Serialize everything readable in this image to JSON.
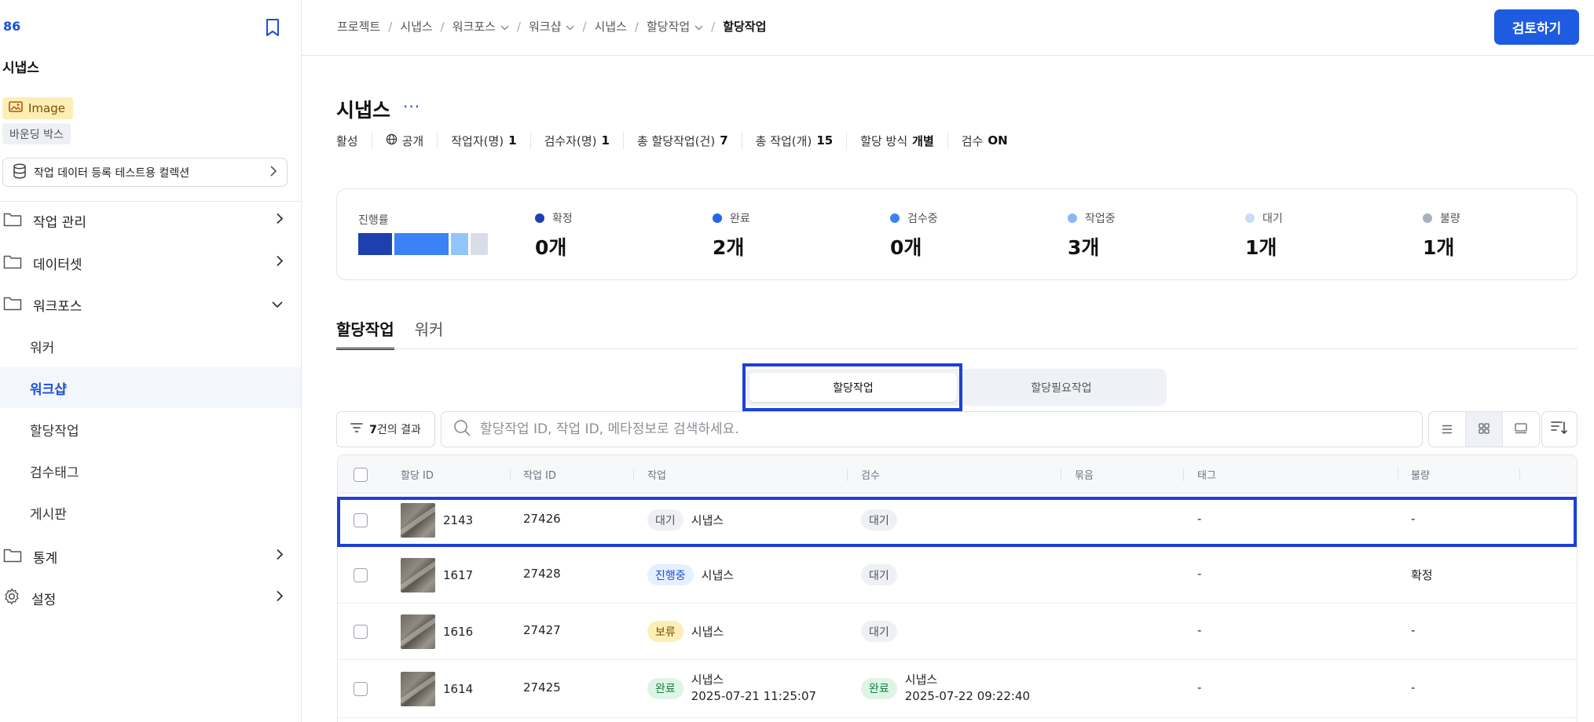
{
  "sidebar": {
    "project_id": "86",
    "project_title": "시냅스",
    "type_badge": "Image",
    "label_badge": "바운딩 박스",
    "collection": "작업 데이터 등록 테스트용 컬렉션",
    "nav": [
      {
        "label": "작업 관리",
        "icon": "folder-icon",
        "state": "collapsed"
      },
      {
        "label": "데이터셋",
        "icon": "folder-icon",
        "state": "collapsed"
      },
      {
        "label": "워크포스",
        "icon": "folder-icon",
        "state": "expanded"
      },
      {
        "label": "통계",
        "icon": "folder-icon",
        "state": "collapsed"
      },
      {
        "label": "설정",
        "icon": "gear-icon",
        "state": "collapsed"
      }
    ],
    "sub_items": [
      "워커",
      "워크샵",
      "할당작업",
      "검수태그",
      "게시판"
    ],
    "active_sub_item": "워크샵"
  },
  "breadcrumb": [
    "프로젝트",
    "시냅스",
    "워크포스",
    "워크샵",
    "시냅스",
    "할당작업",
    "할당작업"
  ],
  "review_button": "검토하기",
  "header": {
    "title": "시냅스",
    "more": "···",
    "meta": [
      {
        "label": "활성",
        "value": ""
      },
      {
        "label": "공개",
        "value": "",
        "icon": "globe-icon"
      },
      {
        "label": "작업자(명)",
        "value": "1"
      },
      {
        "label": "검수자(명)",
        "value": "1"
      },
      {
        "label": "총 할당작업(건)",
        "value": "7"
      },
      {
        "label": "총 작업(개)",
        "value": "15"
      },
      {
        "label": "할당 방식",
        "value": "개별"
      },
      {
        "label": "검수",
        "value": "ON"
      }
    ]
  },
  "stats": {
    "progress_label": "진행률",
    "items": [
      {
        "label": "확정",
        "value": "0개",
        "color": "#1e3fb5"
      },
      {
        "label": "완료",
        "value": "2개",
        "color": "#2563eb"
      },
      {
        "label": "검수중",
        "value": "0개",
        "color": "#3b82f6"
      },
      {
        "label": "작업중",
        "value": "3개",
        "color": "#8ab8f5"
      },
      {
        "label": "대기",
        "value": "1개",
        "color": "#c9dcf5"
      },
      {
        "label": "불량",
        "value": "1개",
        "color": "#a9b0bb"
      }
    ],
    "progress_segments": [
      {
        "color": "#1e40af",
        "fraction": 0.2
      },
      {
        "color": "#3b82f6",
        "fraction": 0.32
      },
      {
        "color": "#93c5fd",
        "fraction": 0.1
      },
      {
        "color": "#d8dee8",
        "fraction": 0.1
      }
    ]
  },
  "tabs": [
    "할당작업",
    "워커"
  ],
  "active_tab": "할당작업",
  "segmented": [
    "할당작업",
    "할당필요작업"
  ],
  "active_segment": "할당작업",
  "toolbar": {
    "result_count": "7",
    "result_suffix": "건의 결과",
    "search_placeholder": "할당작업 ID, 작업 ID, 메타정보로 검색하세요."
  },
  "table": {
    "columns": [
      "할당 ID",
      "작업 ID",
      "작업",
      "검수",
      "묶음",
      "태그",
      "불량"
    ],
    "rows": [
      {
        "assign_id": "2143",
        "task_id": "27426",
        "work_status": "대기",
        "work_status_color": "gray",
        "work_name": "시냅스",
        "work_time": "",
        "review_status": "대기",
        "review_status_color": "gray",
        "review_name": "",
        "review_time": "",
        "bundle": "",
        "tag": "-",
        "defect": "-"
      },
      {
        "assign_id": "1617",
        "task_id": "27428",
        "work_status": "진행중",
        "work_status_color": "blue",
        "work_name": "시냅스",
        "work_time": "",
        "review_status": "대기",
        "review_status_color": "gray",
        "review_name": "",
        "review_time": "",
        "bundle": "",
        "tag": "-",
        "defect": "확정"
      },
      {
        "assign_id": "1616",
        "task_id": "27427",
        "work_status": "보류",
        "work_status_color": "yellow",
        "work_name": "시냅스",
        "work_time": "",
        "review_status": "대기",
        "review_status_color": "gray",
        "review_name": "",
        "review_time": "",
        "bundle": "",
        "tag": "-",
        "defect": "-"
      },
      {
        "assign_id": "1614",
        "task_id": "27425",
        "work_status": "완료",
        "work_status_color": "green",
        "work_name": "시냅스",
        "work_time": "2025-07-21 11:25:07",
        "review_status": "완료",
        "review_status_color": "green",
        "review_name": "시냅스",
        "review_time": "2025-07-22 09:22:40",
        "bundle": "",
        "tag": "-",
        "defect": "-"
      }
    ]
  },
  "colors": {
    "accent": "#1d5be0",
    "highlight": "#1d3fd8"
  }
}
